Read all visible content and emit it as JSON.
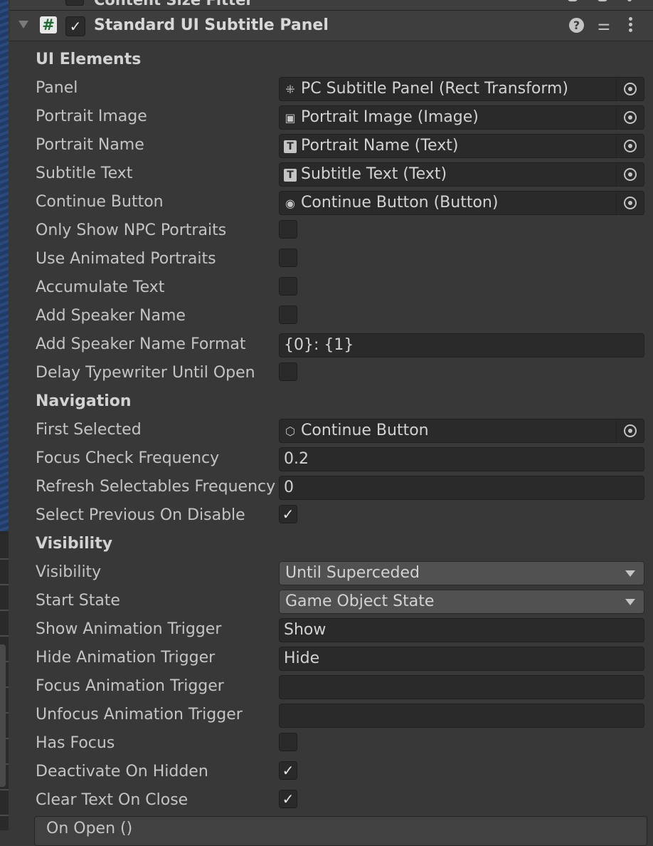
{
  "prev_component": {
    "title": "Content Size Fitter"
  },
  "component": {
    "title": "Standard UI Subtitle Panel",
    "enabled": true,
    "script_icon": "#"
  },
  "icons": {
    "foldout": "foldout-arrow-icon",
    "script": "script-icon",
    "help": "help-icon",
    "presets": "presets-icon",
    "menu": "kebab-menu-icon",
    "rect_transform": "rect-transform-icon",
    "image": "image-icon",
    "text": "text-icon",
    "button": "button-icon",
    "gameobject": "gameobject-cube-icon",
    "object_picker": "object-picker-icon"
  },
  "sections": {
    "ui_elements": "UI Elements",
    "navigation": "Navigation",
    "visibility": "Visibility"
  },
  "fields": {
    "panel": {
      "label": "Panel",
      "value": "PC Subtitle Panel (Rect Transform)"
    },
    "portrait_image": {
      "label": "Portrait Image",
      "value": "Portrait Image (Image)"
    },
    "portrait_name": {
      "label": "Portrait Name",
      "value": "Portrait Name (Text)"
    },
    "subtitle_text": {
      "label": "Subtitle Text",
      "value": "Subtitle Text (Text)"
    },
    "continue_button": {
      "label": "Continue Button",
      "value": "Continue Button (Button)"
    },
    "only_show_npc_portraits": {
      "label": "Only Show NPC Portraits",
      "checked": ""
    },
    "use_animated_portraits": {
      "label": "Use Animated Portraits",
      "checked": ""
    },
    "accumulate_text": {
      "label": "Accumulate Text",
      "checked": ""
    },
    "add_speaker_name": {
      "label": "Add Speaker Name",
      "checked": ""
    },
    "add_speaker_name_format": {
      "label": "Add Speaker Name Format",
      "value": "{0}: {1}"
    },
    "delay_typewriter_until_open": {
      "label": "Delay Typewriter Until Open",
      "checked": ""
    },
    "first_selected": {
      "label": "First Selected",
      "value": "Continue Button"
    },
    "focus_check_frequency": {
      "label": "Focus Check Frequency",
      "value": "0.2"
    },
    "refresh_selectables_frequency": {
      "label": "Refresh Selectables Frequency",
      "value": "0"
    },
    "select_previous_on_disable": {
      "label": "Select Previous On Disable",
      "checked": "✓"
    },
    "visibility": {
      "label": "Visibility",
      "value": "Until Superceded"
    },
    "start_state": {
      "label": "Start State",
      "value": "Game Object State"
    },
    "show_animation_trigger": {
      "label": "Show Animation Trigger",
      "value": "Show"
    },
    "hide_animation_trigger": {
      "label": "Hide Animation Trigger",
      "value": "Hide"
    },
    "focus_animation_trigger": {
      "label": "Focus Animation Trigger",
      "value": ""
    },
    "unfocus_animation_trigger": {
      "label": "Unfocus Animation Trigger",
      "value": ""
    },
    "has_focus": {
      "label": "Has Focus",
      "checked": ""
    },
    "deactivate_on_hidden": {
      "label": "Deactivate On Hidden",
      "checked": "✓"
    },
    "clear_text_on_close": {
      "label": "Clear Text On Close",
      "checked": "✓"
    }
  },
  "event": {
    "label": "On Open ()"
  },
  "colors": {
    "background": "#383838",
    "field_background": "#2a2a2a",
    "dropdown_background": "#515151",
    "text": "#c4c4c4",
    "script_icon_green": "#1d6b2f"
  }
}
